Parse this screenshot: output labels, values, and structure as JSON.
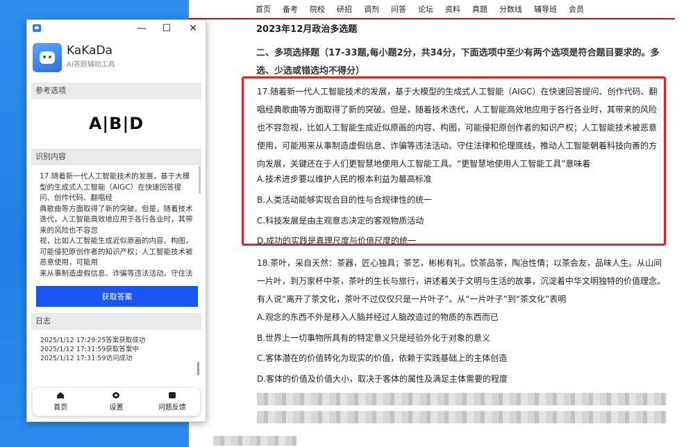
{
  "website": {
    "nav": [
      "首页",
      "备考",
      "院校",
      "研招",
      "调剂",
      "问答",
      "论坛",
      "资料",
      "真题",
      "分数线",
      "辅导班",
      "会员"
    ],
    "page_title": "2023年12月政治多选题",
    "section_header": "二、多项选择题（17-33题,每小题2分，共34分，下面选项中至少有两个选项是符合题目要求的。多选、少选或错选均不得分）",
    "q17": {
      "stem": "17.随着新一代人工智能技术的发展，基于大模型的生成式人工智能（AIGC）在快速回答提问、创作代码、翻唱经典歌曲等方面取得了新的突破。但是，随着技术迭代，人工智能高效地应用于各行各业时，其带来的风险也不容忽视，比如人工智能生成近似原画的内容、构图，可能侵犯原创作者的知识产权；人工智能技术被恶意使用，可能用来从事制造虚假信息、诈骗等违法活动。守住法律和伦理底线，推动人工智能朝着科技向善的方向发展，关键还在于人们更智慧地使用人工智能工具。“更智慧地使用人工智能工具”意味着",
      "options": [
        "A.技术进步要以维护人民的根本利益为最高标准",
        "B.人类活动能够实现合目的性与合规律性的统一",
        "C.科技发展是由主观意志决定的客观物质活动",
        "D.成功的实践是真理尺度与价值尺度的统一"
      ]
    },
    "q18": {
      "stem": "18.茶叶，采自天然：茶器，匠心独具；茶艺，彬彬有礼。饮茶品茶，陶冶性情；以茶会友，品味人生。从山间一片叶，到万家杯中茶，茶叶的生长与旅行，讲述着关于文明与生活的故事，沉淀着中华文明独特的价值理念。有人说“离开了茶文化，茶叶不过仅仅只是一片叶子”。从“一片叶子”到“茶文化”表明",
      "options": [
        "A.观念的东西不外是移入人脑并经过人脑改造过的物质的东西而已",
        "B.世界上一切事物所具有的特定意义只是经验外化于对象的意义",
        "C.客体潜在的价值转化为现实的价值，依赖于实践基础上的主体创造",
        "D.客体的价值及价值大小，取决于客体的属性及满足主体需要的程度"
      ]
    }
  },
  "app": {
    "name": "KaKaDa",
    "subtitle": "AI答题辅助工具",
    "window_controls": [
      "—",
      "☐",
      "✕"
    ],
    "ref_header": "参考选项",
    "answer": "A|B|D",
    "recog_header": "识别内容",
    "recognized_text": "17.随着新一代人工智能技术的发展，基于大模型的生成式人工智能（AIGC）在快速回答提问、创作代码、翻唱经\n典歌曲等方面取得了新的突破。但是，随着技术迭代，人工智能高效地应用于各行各业时，其带来的风险也不容忽\n视，比如人工智能生成近似原画的内容、构图，可能侵犯原创作者的知识产权；人工智能技术被恶意使用，可能用\n来从事制造虚假信息、诈骗等违法活动。守住法律和伦理底线，推动人工智能朝着科技向善",
    "get_button": "获取答案",
    "log_header": "日志",
    "logs": [
      "2025/1/12 17:29:25答案获取成功",
      "2025/1/12 17:31:59获取答案中",
      "2025/1/12 17:31:59访问成功"
    ],
    "tabs": [
      "首页",
      "设置",
      "问题反馈"
    ]
  },
  "colors": {
    "accent_red": "#e8231f",
    "app_blue": "#1a55f0",
    "nav_line": "#b9151b"
  }
}
